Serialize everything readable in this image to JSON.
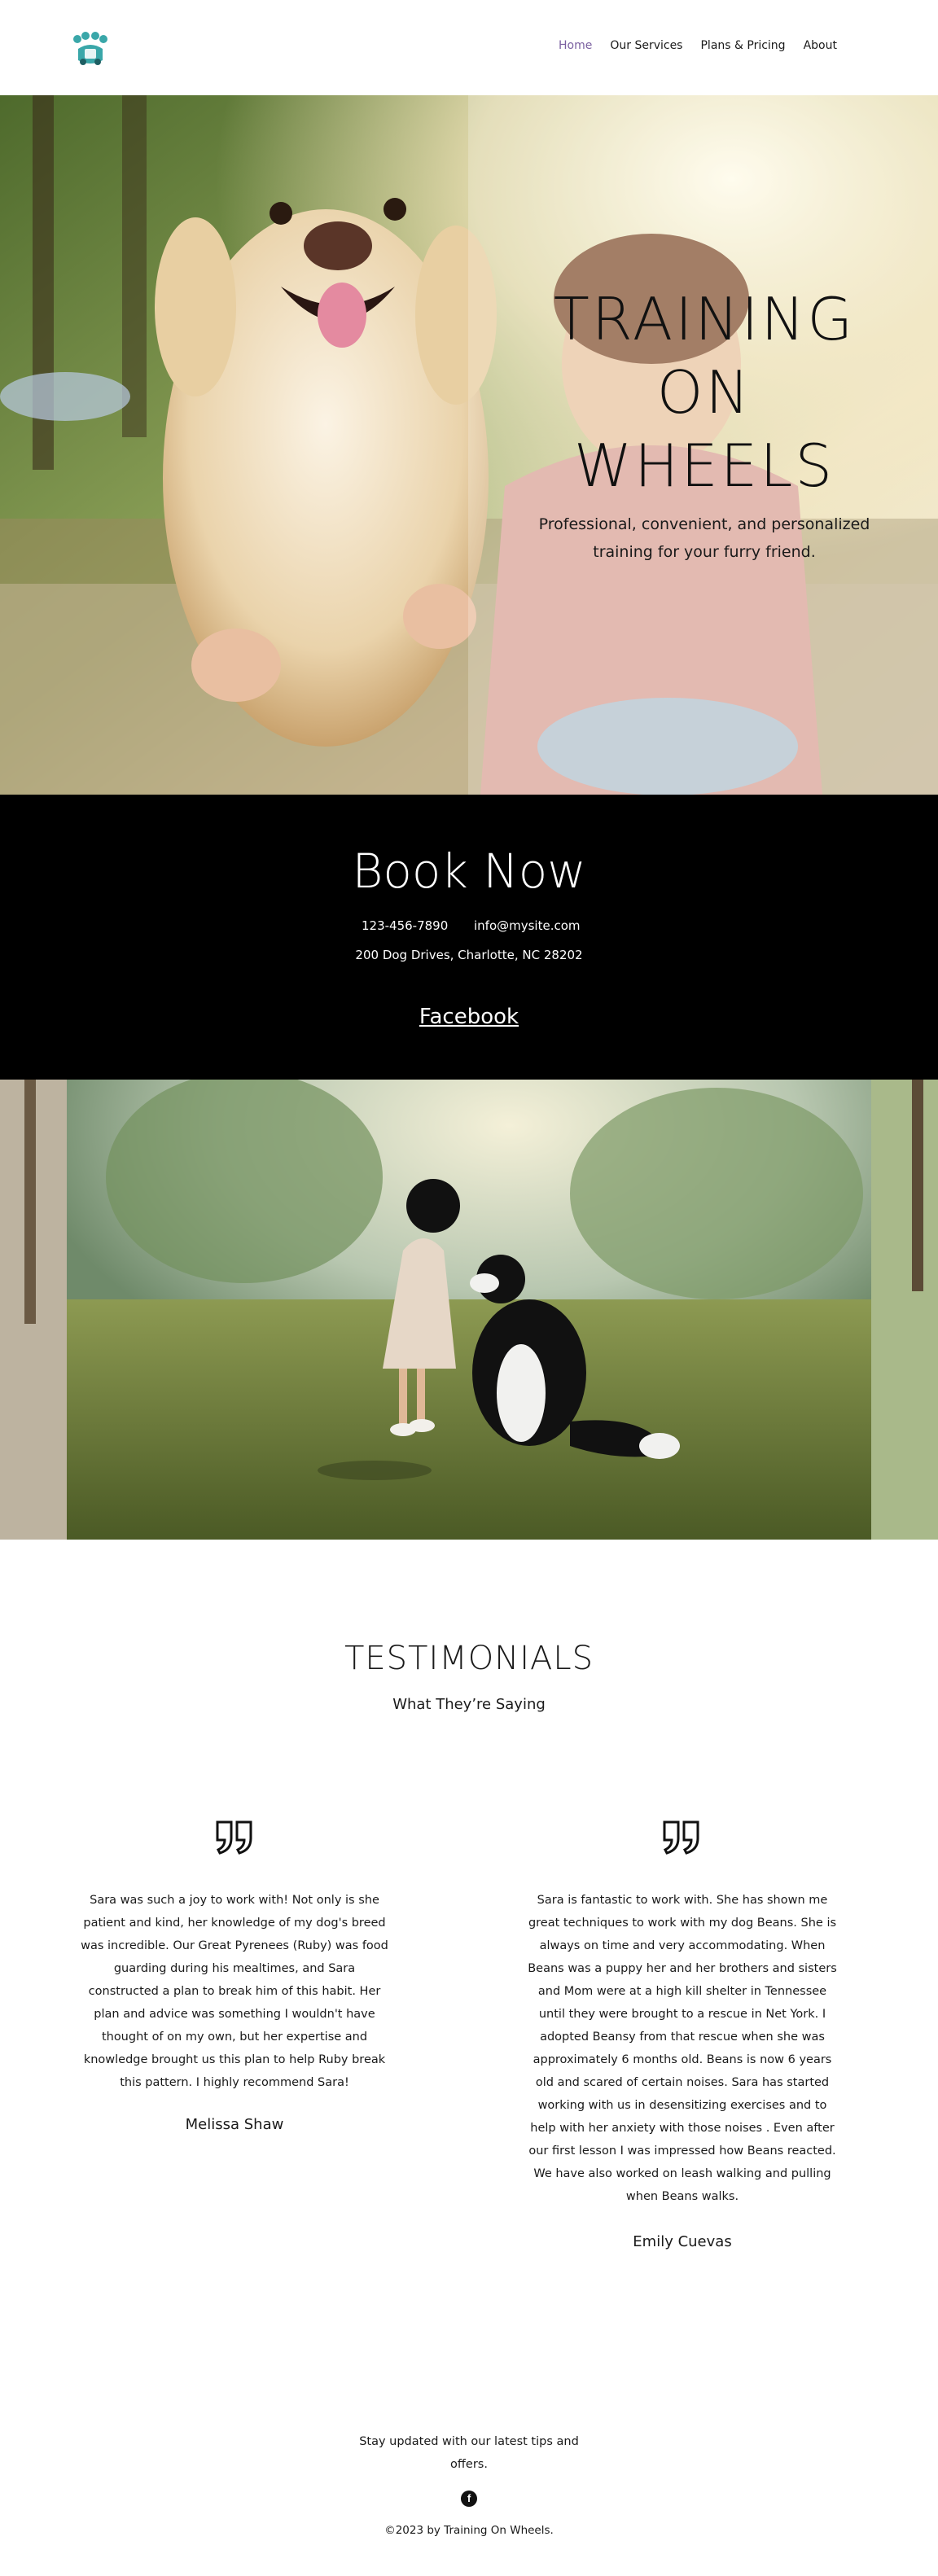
{
  "nav": {
    "items": [
      {
        "label": "Home",
        "active": true
      },
      {
        "label": "Our Services",
        "active": false
      },
      {
        "label": "Plans & Pricing",
        "active": false
      },
      {
        "label": "About",
        "active": false
      }
    ],
    "active_color": "#7a5fa0"
  },
  "hero": {
    "title_line1": "TRAINING",
    "title_line2": "ON",
    "title_line3": "WHEELS",
    "subtitle": "Professional, convenient, and personalized training for your furry friend."
  },
  "book": {
    "title": "Book Now",
    "phone": "123-456-7890",
    "email": "info@mysite.com",
    "address": "200 Dog Drives, Charlotte, NC 28202",
    "facebook": "Facebook"
  },
  "testimonials": {
    "title": "TESTIMONIALS",
    "subtitle": "What They’re Saying",
    "items": [
      {
        "text": "Sara was such a joy to work with! Not only is she patient and kind, her knowledge of my dog's breed was incredible. Our Great Pyrenees (Ruby) was food guarding during his mealtimes, and Sara constructed a plan to break him of this habit. Her plan and advice was something I wouldn't have thought of on my own, but her expertise and knowledge brought us this plan to help Ruby break this pattern. I highly recommend Sara!",
        "name": "Melissa Shaw"
      },
      {
        "text": "Sara is fantastic to work with. She has shown me great techniques to work with my dog Beans. She is always on time and very accommodating. When Beans was a puppy her and her brothers and sisters and Mom were at a high kill shelter in Tennessee until they were brought to a rescue in Net York. I adopted Beansy from that rescue when she was approximately 6 months old. Beans is now 6 years old and scared of certain noises. Sara has started working with us in desensitizing exercises and to help with her anxiety with those noises . Even after our first lesson I was impressed how Beans reacted. We have also worked on leash walking and pulling when Beans walks.",
        "name": "Emily Cuevas"
      }
    ]
  },
  "footer": {
    "text": "Stay updated with our latest tips and offers.",
    "copyright": "©2023 by Training On Wheels."
  },
  "icons": {
    "logo": "paw-wheel-logo",
    "quote": "quote-icon",
    "facebook": "facebook-icon"
  },
  "colors": {
    "brand_teal": "#3aa7a9",
    "book_bg": "#000000"
  }
}
